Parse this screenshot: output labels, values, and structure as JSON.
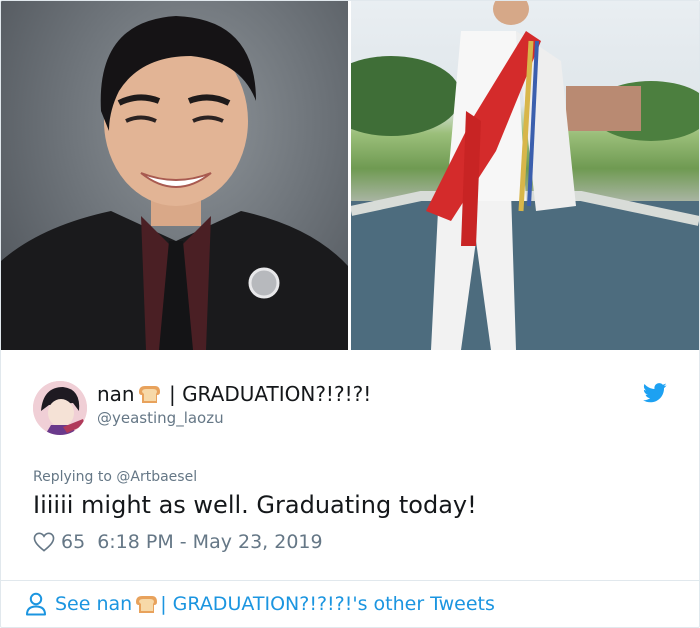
{
  "media": {
    "left_photo": "portrait photo",
    "right_photo": "graduation photo by fountain"
  },
  "user": {
    "display_name_prefix": "nan",
    "display_name_emoji": "bread-emoji",
    "display_name_suffix": " | GRADUATION?!?!?!",
    "handle": "@yeasting_laozu"
  },
  "tweet": {
    "reply_prefix": "Replying to ",
    "reply_mention": "@Artbaesel",
    "text": "Iiiiii might as well. Graduating today!",
    "likes": "65",
    "timestamp": "6:18 PM - May 23, 2019"
  },
  "footer": {
    "see_prefix": "See nan",
    "see_suffix": " | GRADUATION?!?!?!'s other Tweets"
  },
  "colors": {
    "link_blue": "#1b95e0",
    "twitter_blue": "#1da1f2",
    "meta_gray": "#657786",
    "text_dark": "#14171a"
  }
}
